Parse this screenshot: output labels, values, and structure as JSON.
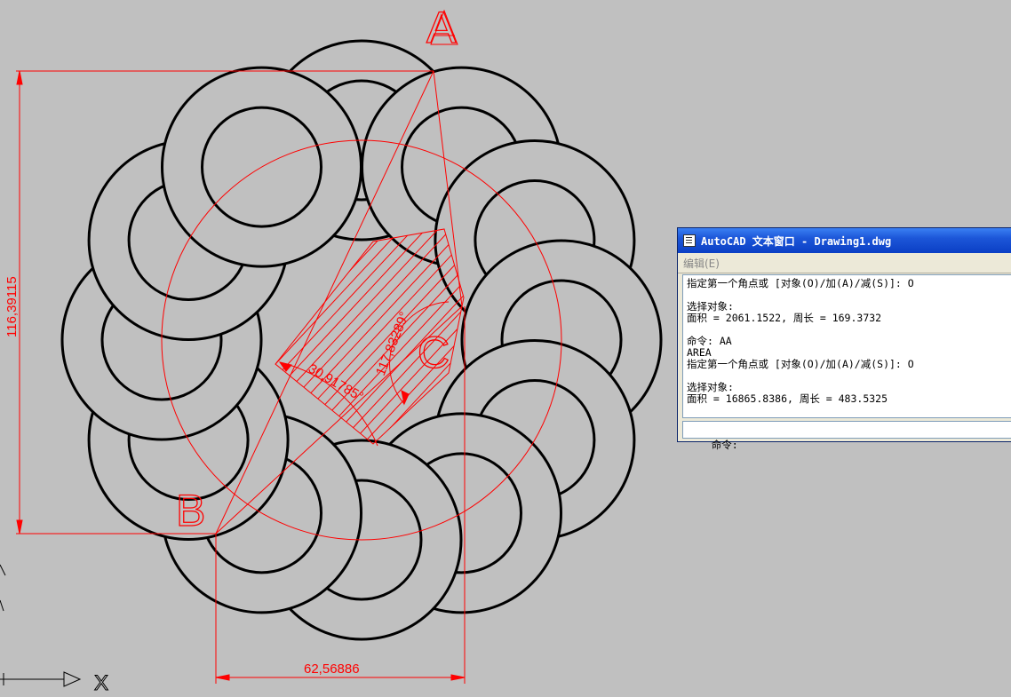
{
  "drawing": {
    "point_labels": {
      "a": "A",
      "b": "B",
      "c": "C"
    },
    "dimensions": {
      "vertical": "116,39115",
      "horizontal": "62,56886",
      "angular_outer": "117,83289°",
      "angular_inner": "30,91785°"
    },
    "ucs": {
      "x_label": "X"
    }
  },
  "text_window": {
    "title": "AutoCAD 文本窗口 - Drawing1.dwg",
    "menu": {
      "edit": "编辑(E)"
    },
    "history": [
      "指定第一个角点或 [对象(O)/加(A)/减(S)]: O",
      "",
      "选择对象:",
      "面积 = 2061.1522, 周长 = 169.3732",
      "",
      "命令: AA",
      "AREA",
      "指定第一个角点或 [对象(O)/加(A)/减(S)]: O",
      "",
      "选择对象:",
      "面积 = 16865.8386, 周长 = 483.5325"
    ],
    "command_prompt": "命令:"
  },
  "colors": {
    "background": "#c0c0c0",
    "annotation": "#ff0000",
    "geometry": "#000000",
    "title_bar": "#0b3fc5"
  }
}
